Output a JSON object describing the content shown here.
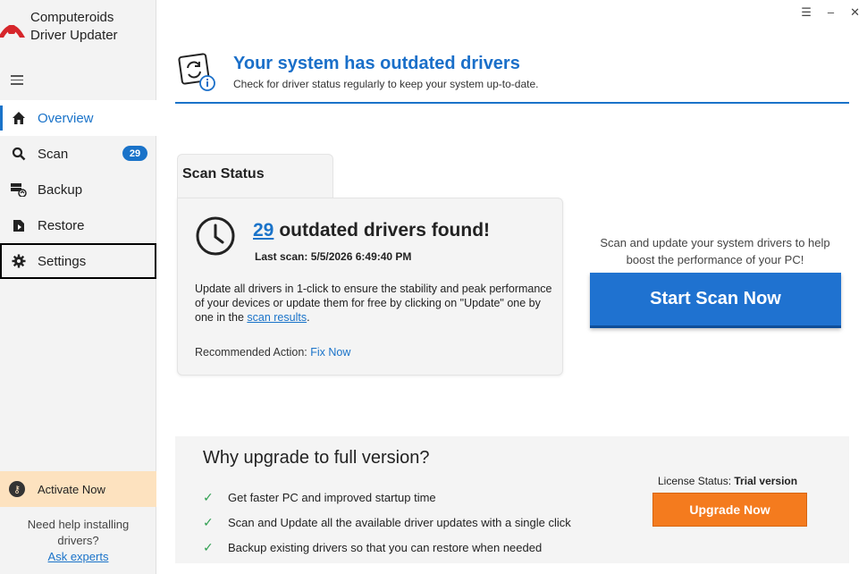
{
  "app": {
    "name_line1": "Computeroids",
    "name_line2": "Driver Updater"
  },
  "window_controls": {
    "menu": "☰",
    "minimize": "–",
    "close": "✕"
  },
  "sidebar": {
    "items": [
      {
        "label": "Overview",
        "icon": "home-icon"
      },
      {
        "label": "Scan",
        "icon": "search-icon",
        "badge": "29"
      },
      {
        "label": "Backup",
        "icon": "backup-icon"
      },
      {
        "label": "Restore",
        "icon": "restore-icon"
      },
      {
        "label": "Settings",
        "icon": "gear-icon"
      }
    ],
    "activate_label": "Activate Now",
    "help_line1": "Need help installing",
    "help_line2": "drivers?",
    "help_link": "Ask experts"
  },
  "header": {
    "title": "Your system has outdated drivers",
    "subtitle": "Check for driver status regularly to keep your system up-to-date."
  },
  "scan_status": {
    "tab_label": "Scan Status",
    "count": "29",
    "found_text": "outdated drivers found!",
    "last_scan": "Last scan: 5/5/2026 6:49:40 PM",
    "desc_part1": "Update all drivers in 1-click to ensure the stability and peak performance of your devices or update them for free by clicking on \"Update\" one by one in the ",
    "desc_link": "scan results",
    "desc_end": ".",
    "rec_label": "Recommended Action: ",
    "rec_link": "Fix Now"
  },
  "cta": {
    "text_line1": "Scan and update your system drivers to help",
    "text_line2": "boost the performance of your PC!",
    "button": "Start Scan Now"
  },
  "upgrade": {
    "title": "Why upgrade to full version?",
    "items": [
      "Get faster PC and improved startup time",
      "Scan and Update all the available driver updates with a single click",
      "Backup existing drivers so that you can restore when needed"
    ],
    "license_label": "License Status: ",
    "license_value": "Trial version",
    "button": "Upgrade Now"
  },
  "colors": {
    "accent": "#1a73c9",
    "orange": "#f47b1e",
    "activate_bg": "#fde2bf",
    "check": "#2e9e4f"
  }
}
